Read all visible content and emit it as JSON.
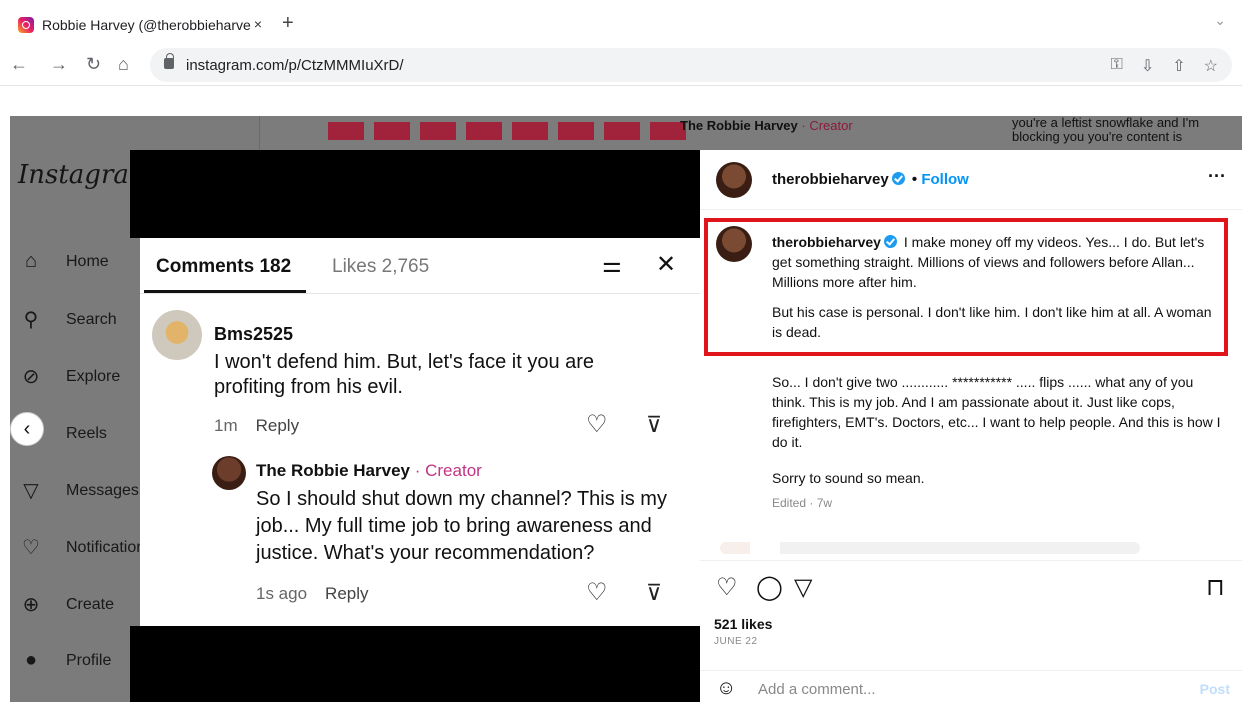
{
  "browser": {
    "tab_title": "Robbie Harvey (@therobbieharve",
    "tab_close": "×",
    "new_tab": "+",
    "url": "instagram.com/p/CtzMMMIuXrD/"
  },
  "background": {
    "logo": "Instagram",
    "nav": [
      {
        "icon": "⌂",
        "label": "Home"
      },
      {
        "icon": "⚲",
        "label": "Search"
      },
      {
        "icon": "⊘",
        "label": "Explore"
      },
      {
        "icon": "▶",
        "label": "Reels"
      },
      {
        "icon": "▽",
        "label": "Messages"
      },
      {
        "icon": "♡",
        "label": "Notifications"
      },
      {
        "icon": "⊕",
        "label": "Create"
      },
      {
        "icon": "●",
        "label": "Profile"
      }
    ],
    "creator_text": "The Robbie Harvey",
    "creator_badge": "· Creator",
    "top_right_text": "you're a leftist snowflake and I'm blocking you you're content is"
  },
  "comments_card": {
    "tab_comments": "Comments 182",
    "tab_likes": "Likes 2,765",
    "comment1": {
      "user": "Bms2525",
      "text": "I won't defend him. But, let's face it you are profiting from his evil.",
      "time": "1m",
      "reply": "Reply"
    },
    "comment2": {
      "user": "The Robbie Harvey",
      "badge": "· Creator",
      "text": "So I should shut down my channel? This is my job... My full time job to bring awareness and justice. What's your recommendation?",
      "time": "1s ago",
      "reply": "Reply"
    }
  },
  "post_panel": {
    "username": "therobbieharvey",
    "dot": "•",
    "follow": "Follow",
    "more": "···",
    "caption_user": "therobbieharvey",
    "caption_p1": "I make money off my videos. Yes... I do. But let's get something straight. Millions of views and followers before Allan... Millions more after him.",
    "caption_p2": "But his case is personal. I don't like him. I don't like him at all. A woman is dead.",
    "caption_p3": "So... I don't give two ............ *********** ..... flips ...... what any of you think. This is my job. And I am passionate about it. Just like cops, firefighters, EMT's. Doctors, etc... I want to help people. And this is how I do it.",
    "caption_p4": "Sorry to sound so mean.",
    "edited": "Edited · 7w",
    "likes": "521 likes",
    "date": "JUNE 22",
    "add_comment_placeholder": "Add a comment...",
    "post_button": "Post"
  },
  "colors": {
    "highlight_border": "#e0151b",
    "follow_blue": "#0095f6",
    "creator_pink": "#c13584"
  }
}
